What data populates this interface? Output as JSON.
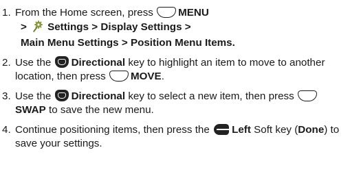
{
  "steps": [
    {
      "number": "1.",
      "from_home": "From the Home screen, press",
      "menu": "MENU",
      "gt1": ">",
      "settings": "Settings",
      "gt2": ">",
      "display_settings": "Display Settings",
      "gt3": ">",
      "main_menu_settings": "Main Menu Settings",
      "gt4": ">",
      "position_menu_items": "Position Menu Items",
      "end": "."
    },
    {
      "number": "2.",
      "use_the": "Use the",
      "directional": "Directional",
      "rest": "key to highlight an item to move to another location, then press",
      "move": "MOVE",
      "end": "."
    },
    {
      "number": "3.",
      "use_the": "Use the",
      "directional": "Directional",
      "rest_a": "key to select a new item, then press",
      "swap": "SWAP",
      "rest_b": "to save the new menu."
    },
    {
      "number": "4.",
      "continue": "Continue positioning items, then press the",
      "left": "Left",
      "soft_key": "Soft key (",
      "done": "Done",
      "rest": ") to save your settings."
    }
  ],
  "icons": [
    "center-key-icon",
    "settings-icon",
    "directional-key-icon",
    "left-soft-key-icon"
  ]
}
